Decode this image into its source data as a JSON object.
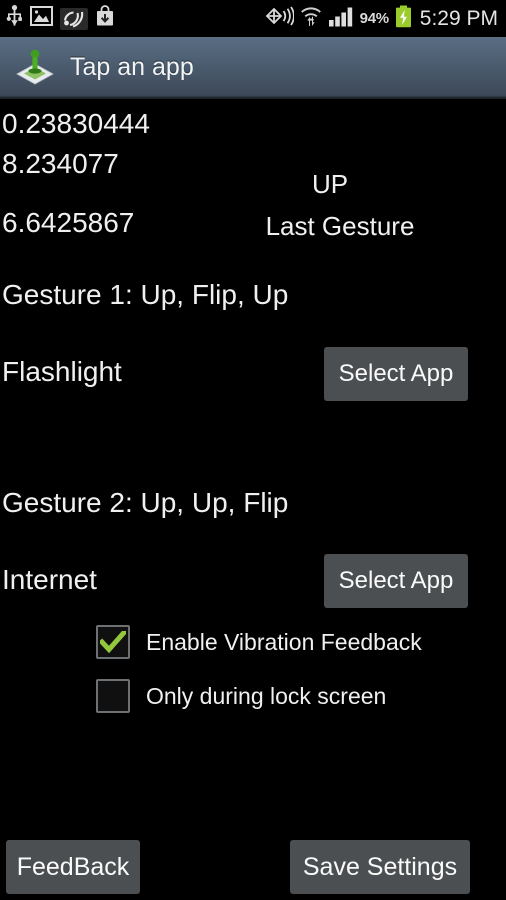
{
  "status_bar": {
    "left_icons": [
      {
        "name": "usb-icon",
        "glyph": "usb"
      },
      {
        "name": "gallery-icon",
        "glyph": "picture"
      },
      {
        "name": "nfc-icon",
        "glyph": "sound-waves"
      },
      {
        "name": "download-icon",
        "glyph": "download-bag"
      }
    ],
    "right_icons": [
      {
        "name": "gps-icon",
        "glyph": "location-waves"
      },
      {
        "name": "wifi-icon",
        "glyph": "wifi-transfer"
      },
      {
        "name": "signal-icon",
        "glyph": "signal-bars"
      }
    ],
    "battery_percent": "94%",
    "battery_state": "charging",
    "clock": "5:29 PM"
  },
  "action_bar": {
    "title": "Tap an app",
    "icon_name": "app-logo-icon"
  },
  "sensors": {
    "x": "0.23830444",
    "y": "8.234077",
    "z": "6.6425867"
  },
  "last_gesture": {
    "value": "UP",
    "label": "Last Gesture"
  },
  "gestures": [
    {
      "heading": "Gesture 1: Up, Flip, Up",
      "app": "Flashlight",
      "button": "Select App"
    },
    {
      "heading": "Gesture 2: Up, Up, Flip",
      "app": "Internet",
      "button": "Select App"
    }
  ],
  "checkboxes": [
    {
      "label": "Enable Vibration Feedback",
      "checked": true
    },
    {
      "label": "Only during lock screen",
      "checked": false
    }
  ],
  "footer": {
    "feedback": "FeedBack",
    "save": "Save Settings"
  },
  "colors": {
    "background": "#000000",
    "action_bar_top": "#5a6e84",
    "action_bar_bottom": "#3d4857",
    "button": "#4b4f51",
    "check_green": "#93c83d",
    "text": "#f0f0f0"
  }
}
